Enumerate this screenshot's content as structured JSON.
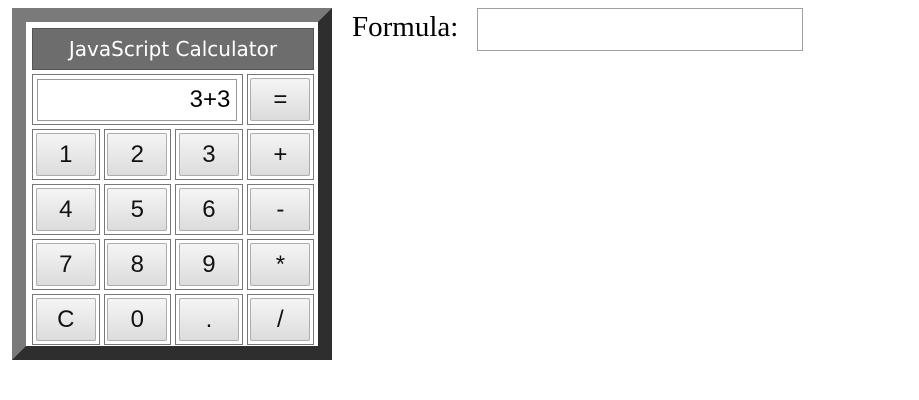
{
  "calculator": {
    "title": "JavaScript Calculator",
    "display": "3+3",
    "equals_label": "=",
    "rows": [
      [
        "1",
        "2",
        "3",
        "+"
      ],
      [
        "4",
        "5",
        "6",
        "-"
      ],
      [
        "7",
        "8",
        "9",
        "*"
      ],
      [
        "C",
        "0",
        ".",
        "/"
      ]
    ]
  },
  "formula": {
    "label": "Formula:",
    "value": "",
    "placeholder": ""
  }
}
